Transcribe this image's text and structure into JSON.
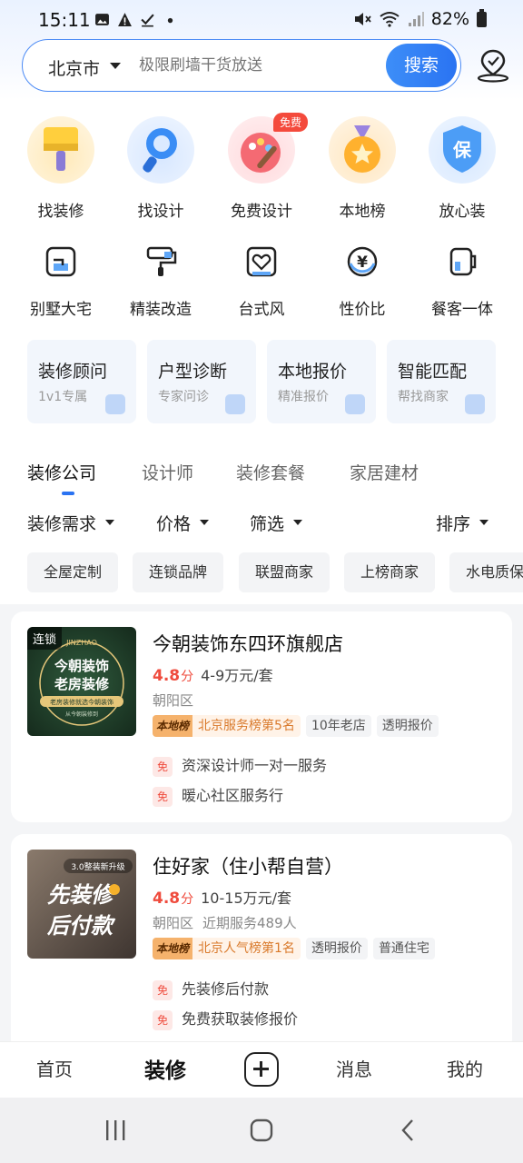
{
  "status_bar": {
    "time": "15:11",
    "battery": "82%"
  },
  "search": {
    "city": "北京市",
    "placeholder": "极限刷墙干货放送",
    "button": "搜索"
  },
  "categories": [
    {
      "label": "找装修",
      "icon": "roller-brush-icon",
      "color": "#ffce3a"
    },
    {
      "label": "找设计",
      "icon": "magnifier-icon",
      "color": "#3a8df5"
    },
    {
      "label": "免费设计",
      "icon": "palette-icon",
      "color": "#f46a73",
      "badge": "免费"
    },
    {
      "label": "本地榜",
      "icon": "medal-icon",
      "color": "#ffb12e"
    },
    {
      "label": "放心装",
      "icon": "shield-icon",
      "color": "#4c9df6",
      "glyph": "保"
    }
  ],
  "styles": [
    {
      "label": "别墅大宅",
      "icon": "villa-icon"
    },
    {
      "label": "精装改造",
      "icon": "paint-roller-icon"
    },
    {
      "label": "台式风",
      "icon": "heart-frame-icon"
    },
    {
      "label": "性价比",
      "icon": "yen-coin-icon",
      "glyph": "¥"
    },
    {
      "label": "餐客一体",
      "icon": "cup-icon"
    }
  ],
  "services": [
    {
      "title": "装修顾问",
      "subtitle": "1v1专属",
      "icon": "user-icon"
    },
    {
      "title": "户型诊断",
      "subtitle": "专家问诊",
      "icon": "medical-kit-icon"
    },
    {
      "title": "本地报价",
      "subtitle": "精准报价",
      "icon": "calculator-icon"
    },
    {
      "title": "智能匹配",
      "subtitle": "帮找商家",
      "icon": "check-box-icon"
    }
  ],
  "tabs": [
    "装修公司",
    "设计师",
    "装修套餐",
    "家居建材"
  ],
  "filters": [
    "装修需求",
    "价格",
    "筛选",
    "排序"
  ],
  "chips": [
    "全屋定制",
    "连锁品牌",
    "联盟商家",
    "上榜商家",
    "水电质保"
  ],
  "stores": [
    {
      "name": "今朝装饰东四环旗舰店",
      "rating": "4.8",
      "rating_unit": "分",
      "price": "4-9万元/套",
      "district": "朝阳区",
      "service_count": "",
      "chain_label": "连锁",
      "image": {
        "brand": "JINZHAO",
        "line1": "今朝装饰",
        "line2": "老房装修",
        "caption": "老房装修就选今朝装饰",
        "footer": "从今朝装修到",
        "bg": "#1f3b2a"
      },
      "rank_logo": "本地榜",
      "rank_text": "北京服务榜第5名",
      "tags": [
        "10年老店",
        "透明报价"
      ],
      "perk_badge": "免",
      "perks": [
        "资深设计师一对一服务",
        "暖心社区服务行"
      ]
    },
    {
      "name": "住好家（住小帮自营）",
      "rating": "4.8",
      "rating_unit": "分",
      "price": "10-15万元/套",
      "district": "朝阳区",
      "service_count": "近期服务489人",
      "image": {
        "line0": "3.0整装新升级",
        "line1": "先装修",
        "line2": "后付款",
        "bg": "#5a5048"
      },
      "rank_logo": "本地榜",
      "rank_text": "北京人气榜第1名",
      "tags": [
        "透明报价",
        "普通住宅"
      ],
      "perk_badge": "免",
      "perks": [
        "先装修后付款",
        "免费获取装修报价"
      ]
    }
  ],
  "bottom_nav": [
    "首页",
    "装修",
    "消息",
    "我的"
  ],
  "colors": {
    "accent": "#2a73f2",
    "price_red": "#ef4b3d",
    "rank_orange": "#d9792a"
  }
}
